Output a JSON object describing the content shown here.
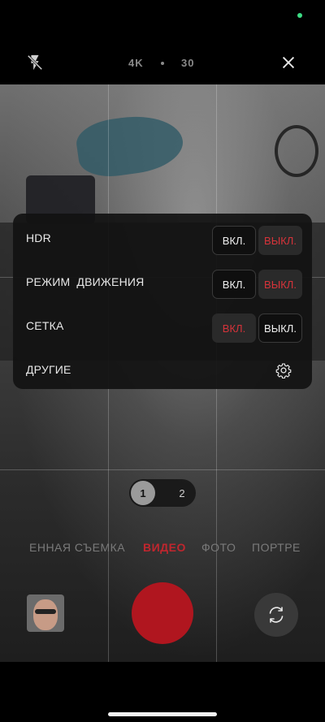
{
  "top_bar": {
    "resolution": "4K",
    "fps": "30",
    "flash_icon": "flash-off-icon",
    "close_icon": "close-icon"
  },
  "settings": {
    "rows": [
      {
        "label": "HDR",
        "on": "ВКЛ.",
        "off": "ВЫКЛ.",
        "selected": "off"
      },
      {
        "label": "РЕЖИМ ДВИЖЕНИЯ",
        "on": "ВКЛ.",
        "off": "ВЫКЛ.",
        "selected": "off"
      },
      {
        "label": "СЕТКА",
        "on": "ВКЛ.",
        "off": "ВЫКЛ.",
        "selected": "on"
      }
    ],
    "other_label": "ДРУГИЕ",
    "other_icon": "gear-icon"
  },
  "zoom": {
    "option1": "1",
    "option2": "2",
    "selected": "1"
  },
  "modes": {
    "items": [
      "ЕННАЯ СЪЕМКА",
      "ВИДЕО",
      "ФОТО",
      "ПОРТРЕ"
    ],
    "active": "ВИДЕО"
  },
  "colors": {
    "accent": "#c0262e",
    "shutter": "#b0161f",
    "status_dot": "#3ddc84"
  }
}
